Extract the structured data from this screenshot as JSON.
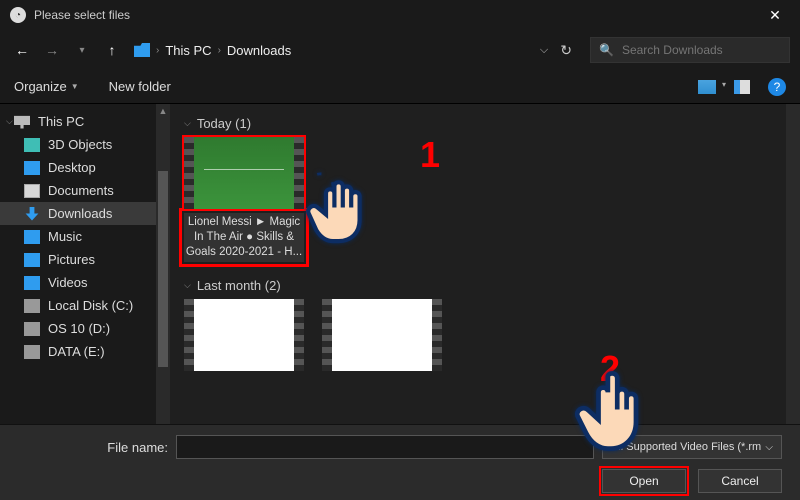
{
  "window": {
    "title": "Please select files"
  },
  "path": {
    "root": "This PC",
    "folder": "Downloads"
  },
  "search": {
    "placeholder": "Search Downloads"
  },
  "toolbar": {
    "organize": "Organize",
    "new_folder": "New folder"
  },
  "sidebar": {
    "items": [
      {
        "label": "This PC"
      },
      {
        "label": "3D Objects"
      },
      {
        "label": "Desktop"
      },
      {
        "label": "Documents"
      },
      {
        "label": "Downloads"
      },
      {
        "label": "Music"
      },
      {
        "label": "Pictures"
      },
      {
        "label": "Videos"
      },
      {
        "label": "Local Disk (C:)"
      },
      {
        "label": "OS 10 (D:)"
      },
      {
        "label": "DATA (E:)"
      }
    ]
  },
  "content": {
    "groups": [
      {
        "header": "Today (1)",
        "files": [
          {
            "caption": "Lionel Messi ► Magic In The Air ● Skills & Goals 2020-2021 - H..."
          }
        ]
      },
      {
        "header": "Last month (2)",
        "files": [
          {
            "caption": ""
          },
          {
            "caption": ""
          }
        ]
      }
    ]
  },
  "footer": {
    "filename_label": "File name:",
    "filename_value": "",
    "filetype": "All Supported Video Files (*.rm",
    "open": "Open",
    "cancel": "Cancel"
  },
  "annotations": {
    "one": "1",
    "two": "2"
  }
}
